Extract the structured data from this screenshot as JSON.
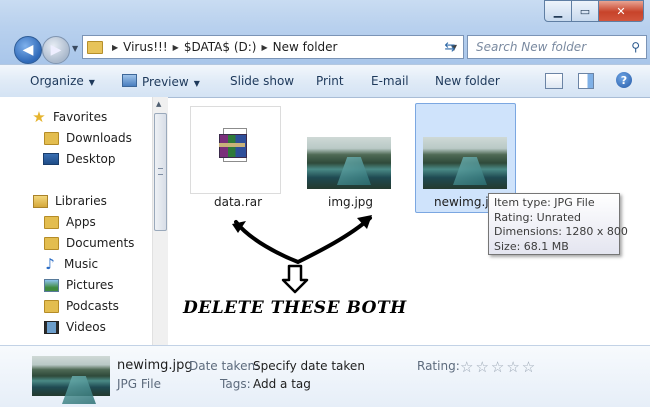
{
  "window": {
    "minimize_icon": "minimize-icon",
    "maximize_icon": "maximize-icon",
    "close_icon": "close-icon"
  },
  "address": {
    "crumbs": [
      "Virus!!!",
      "$DATA$ (D:)",
      "New folder"
    ]
  },
  "search": {
    "placeholder": "Search New folder"
  },
  "toolbar": {
    "organize": "Organize",
    "preview": "Preview",
    "slideshow": "Slide show",
    "print": "Print",
    "email": "E-mail",
    "new_folder": "New folder"
  },
  "nav": {
    "favorites": "Favorites",
    "downloads": "Downloads",
    "desktop": "Desktop",
    "libraries": "Libraries",
    "apps": "Apps",
    "documents": "Documents",
    "music": "Music",
    "pictures": "Pictures",
    "podcasts": "Podcasts",
    "videos": "Videos"
  },
  "files": [
    {
      "name": "data.rar",
      "type": "archive"
    },
    {
      "name": "img.jpg",
      "type": "image"
    },
    {
      "name": "newimg.jpg",
      "type": "image",
      "selected": true
    }
  ],
  "tooltip": {
    "item_type": "Item type: JPG File",
    "rating": "Rating: Unrated",
    "dimensions": "Dimensions: 1280 x 800",
    "size": "Size: 68.1 MB"
  },
  "annotation": {
    "caption": "DELETE THESE BOTH"
  },
  "details": {
    "filename": "newimg.jpg",
    "filetype": "JPG File",
    "date_taken_label": "Date taken:",
    "date_taken_value": "Specify date taken",
    "tags_label": "Tags:",
    "tags_value": "Add a tag",
    "rating_label": "Rating:",
    "stars": "☆☆☆☆☆"
  },
  "colors": {
    "chrome": "#b9d1ee",
    "selection": "#cfe3fb",
    "selection_border": "#7ba7e1",
    "close_button": "#c7432a"
  }
}
